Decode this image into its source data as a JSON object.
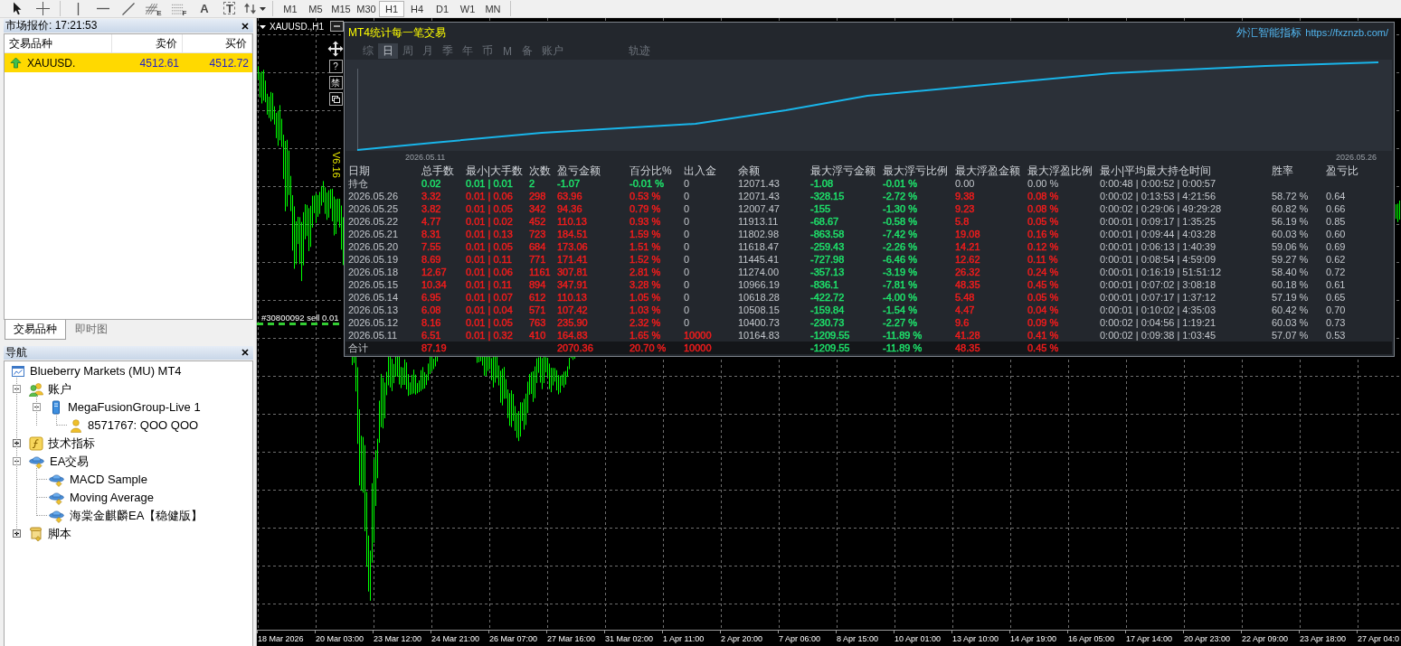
{
  "toolbar": {
    "tools": [
      {
        "kind": "cursor"
      },
      {
        "kind": "crosshair"
      },
      {
        "kind": "vertical-line"
      },
      {
        "kind": "horizontal-line"
      },
      {
        "kind": "trend-line"
      },
      {
        "kind": "fibonacci",
        "letter": "E"
      },
      {
        "kind": "fibonacci-levels",
        "letter": "F"
      },
      {
        "kind": "text",
        "label": "A"
      },
      {
        "kind": "text-label",
        "label": "T"
      },
      {
        "kind": "arrows"
      }
    ],
    "periods": [
      {
        "label": "M1",
        "selected": false
      },
      {
        "label": "M5",
        "selected": false
      },
      {
        "label": "M15",
        "selected": false
      },
      {
        "label": "M30",
        "selected": false
      },
      {
        "label": "H1",
        "selected": true
      },
      {
        "label": "H4",
        "selected": false
      },
      {
        "label": "D1",
        "selected": false
      },
      {
        "label": "W1",
        "selected": false
      },
      {
        "label": "MN",
        "selected": false
      }
    ]
  },
  "market_watch": {
    "title": "市场报价: 17:21:53",
    "columns": [
      "交易品种",
      "卖价",
      "买价"
    ],
    "rows": [
      {
        "symbol": "XAUUSD.",
        "bid": "4512.61",
        "ask": "4512.72",
        "rising": true,
        "selected": true
      }
    ],
    "tabs": [
      {
        "label": "交易品种",
        "selected": true
      },
      {
        "label": "即时图",
        "selected": false
      }
    ]
  },
  "navigator": {
    "title": "导航",
    "tree": [
      {
        "label": "Blueberry Markets (MU) MT4",
        "kind": "terminal",
        "children": [
          {
            "label": "账户",
            "kind": "accounts",
            "expanded": true,
            "children": [
              {
                "label": "MegaFusionGroup-Live 1",
                "kind": "server",
                "expanded": true,
                "children": [
                  {
                    "label": "8571767: QOO QOO",
                    "kind": "account"
                  }
                ]
              }
            ]
          },
          {
            "label": "技术指标",
            "kind": "indicators",
            "expanded": false
          },
          {
            "label": "EA交易",
            "kind": "experts",
            "expanded": true,
            "children": [
              {
                "label": "MACD Sample",
                "kind": "expert"
              },
              {
                "label": "Moving Average",
                "kind": "expert"
              },
              {
                "label": "海棠金麒麟EA【稳健版】",
                "kind": "expert"
              }
            ]
          },
          {
            "label": "脚本",
            "kind": "scripts",
            "expanded": false
          }
        ]
      }
    ]
  },
  "chart": {
    "title": "XAUUSD.,H1",
    "side_buttons": [
      {
        "kind": "move"
      },
      {
        "kind": "text",
        "label": "?"
      },
      {
        "kind": "text",
        "label": "禁"
      },
      {
        "kind": "window"
      }
    ],
    "version": "V6.16",
    "order_label": "#30800092 sell 0.01",
    "time_axis": [
      "18 Mar 2026",
      "20 Mar 03:00",
      "23 Mar 12:00",
      "24 Mar 21:00",
      "26 Mar 07:00",
      "27 Mar 16:00",
      "31 Mar 02:00",
      "1 Apr 11:00",
      "2 Apr 20:00",
      "7 Apr 06:00",
      "8 Apr 15:00",
      "10 Apr 01:00",
      "13 Apr 10:00",
      "14 Apr 19:00",
      "16 Apr 05:00",
      "17 Apr 14:00",
      "20 Apr 23:00",
      "22 Apr 09:00",
      "23 Apr 18:00",
      "27 Apr 04:0"
    ]
  },
  "stats_panel": {
    "title": "MT4统计每一笔交易",
    "brand": "外汇智能指标",
    "link": "https://fxznzb.com/",
    "tab_groups": [
      [
        {
          "label": "综",
          "selected": false
        },
        {
          "label": "日",
          "selected": true
        },
        {
          "label": "周",
          "selected": false
        },
        {
          "label": "月",
          "selected": false
        },
        {
          "label": "季",
          "selected": false
        },
        {
          "label": "年",
          "selected": false
        },
        {
          "label": "币",
          "selected": false
        },
        {
          "label": "M",
          "selected": false
        },
        {
          "label": "备",
          "selected": false
        },
        {
          "label": "账户",
          "selected": false
        }
      ],
      [
        {
          "label": "轨迹",
          "selected": false
        }
      ]
    ],
    "equity_dates": [
      "2026.05.11",
      "2026.05.26"
    ],
    "table": {
      "columns": [
        "日期",
        "总手数",
        "最小|大手数",
        "次数",
        "盈亏金额",
        "百分比%",
        "出入金",
        "余额",
        "最大浮亏金额",
        "最大浮亏比例",
        "最大浮盈金额",
        "最大浮盈比例",
        "最小|平均最大持仓时间",
        "胜率",
        "盈亏比"
      ],
      "rows": [
        {
          "kind": "data",
          "date": {
            "text": "持仓"
          },
          "lots": {
            "text": "0.02",
            "color": "#1ee36b"
          },
          "min_max_lots": {
            "text": "0.01 | 0.01",
            "color": "#1ee36b"
          },
          "trades": {
            "text": "2",
            "color": "#1ee36b"
          },
          "profit": {
            "text": "-1.07",
            "color": "#1ee36b"
          },
          "percent": {
            "text": "-0.01 %",
            "color": "#1ee36b"
          },
          "deposit": {
            "text": "0"
          },
          "balance": {
            "text": "12071.43"
          },
          "max_float_loss": {
            "text": "-1.08",
            "color": "#1ee36b"
          },
          "max_float_loss_pct": {
            "text": "-0.01 %",
            "color": "#1ee36b"
          },
          "max_float_profit": {
            "text": "0.00"
          },
          "max_float_profit_pct": {
            "text": "0.00 %"
          },
          "hold_time": {
            "text": "0:00:48 | 0:00:52 | 0:00:57"
          }
        },
        {
          "kind": "data",
          "date": {
            "text": "2026.05.26"
          },
          "lots": {
            "text": "3.32",
            "color": "#f21c1c"
          },
          "min_max_lots": {
            "text": "0.01 | 0.06",
            "color": "#f21c1c"
          },
          "trades": {
            "text": "298",
            "color": "#f21c1c"
          },
          "profit": {
            "text": "63.96",
            "color": "#f21c1c"
          },
          "percent": {
            "text": "0.53 %",
            "color": "#f21c1c"
          },
          "deposit": {
            "text": "0"
          },
          "balance": {
            "text": "12071.43"
          },
          "max_float_loss": {
            "text": "-328.15",
            "color": "#1ee36b"
          },
          "max_float_loss_pct": {
            "text": "-2.72 %",
            "color": "#1ee36b"
          },
          "max_float_profit": {
            "text": "9.38",
            "color": "#f21c1c"
          },
          "max_float_profit_pct": {
            "text": "0.08 %",
            "color": "#f21c1c"
          },
          "hold_time": {
            "text": "0:00:02 | 0:13:53 | 4:21:56"
          },
          "win_rate": {
            "text": "58.72 %"
          },
          "profit_ratio": {
            "text": "0.64"
          }
        },
        {
          "kind": "data",
          "date": {
            "text": "2026.05.25"
          },
          "lots": {
            "text": "3.82",
            "color": "#f21c1c"
          },
          "min_max_lots": {
            "text": "0.01 | 0.05",
            "color": "#f21c1c"
          },
          "trades": {
            "text": "342",
            "color": "#f21c1c"
          },
          "profit": {
            "text": "94.36",
            "color": "#f21c1c"
          },
          "percent": {
            "text": "0.79 %",
            "color": "#f21c1c"
          },
          "deposit": {
            "text": "0"
          },
          "balance": {
            "text": "12007.47"
          },
          "max_float_loss": {
            "text": "-155",
            "color": "#1ee36b"
          },
          "max_float_loss_pct": {
            "text": "-1.30 %",
            "color": "#1ee36b"
          },
          "max_float_profit": {
            "text": "9.23",
            "color": "#f21c1c"
          },
          "max_float_profit_pct": {
            "text": "0.08 %",
            "color": "#f21c1c"
          },
          "hold_time": {
            "text": "0:00:02 | 0:29:06 | 49:29:28"
          },
          "win_rate": {
            "text": "60.82 %"
          },
          "profit_ratio": {
            "text": "0.66"
          }
        },
        {
          "kind": "data",
          "date": {
            "text": "2026.05.22"
          },
          "lots": {
            "text": "4.77",
            "color": "#f21c1c"
          },
          "min_max_lots": {
            "text": "0.01 | 0.02",
            "color": "#f21c1c"
          },
          "trades": {
            "text": "452",
            "color": "#f21c1c"
          },
          "profit": {
            "text": "110.13",
            "color": "#f21c1c"
          },
          "percent": {
            "text": "0.93 %",
            "color": "#f21c1c"
          },
          "deposit": {
            "text": "0"
          },
          "balance": {
            "text": "11913.11"
          },
          "max_float_loss": {
            "text": "-68.67",
            "color": "#1ee36b"
          },
          "max_float_loss_pct": {
            "text": "-0.58 %",
            "color": "#1ee36b"
          },
          "max_float_profit": {
            "text": "5.8",
            "color": "#f21c1c"
          },
          "max_float_profit_pct": {
            "text": "0.05 %",
            "color": "#f21c1c"
          },
          "hold_time": {
            "text": "0:00:01 | 0:09:17 | 1:35:25"
          },
          "win_rate": {
            "text": "56.19 %"
          },
          "profit_ratio": {
            "text": "0.85"
          }
        },
        {
          "kind": "data",
          "date": {
            "text": "2026.05.21"
          },
          "lots": {
            "text": "8.31",
            "color": "#f21c1c"
          },
          "min_max_lots": {
            "text": "0.01 | 0.13",
            "color": "#f21c1c"
          },
          "trades": {
            "text": "723",
            "color": "#f21c1c"
          },
          "profit": {
            "text": "184.51",
            "color": "#f21c1c"
          },
          "percent": {
            "text": "1.59 %",
            "color": "#f21c1c"
          },
          "deposit": {
            "text": "0"
          },
          "balance": {
            "text": "11802.98"
          },
          "max_float_loss": {
            "text": "-863.58",
            "color": "#1ee36b"
          },
          "max_float_loss_pct": {
            "text": "-7.42 %",
            "color": "#1ee36b"
          },
          "max_float_profit": {
            "text": "19.08",
            "color": "#f21c1c"
          },
          "max_float_profit_pct": {
            "text": "0.16 %",
            "color": "#f21c1c"
          },
          "hold_time": {
            "text": "0:00:01 | 0:09:44 | 4:03:28"
          },
          "win_rate": {
            "text": "60.03 %"
          },
          "profit_ratio": {
            "text": "0.60"
          }
        },
        {
          "kind": "data",
          "date": {
            "text": "2026.05.20"
          },
          "lots": {
            "text": "7.55",
            "color": "#f21c1c"
          },
          "min_max_lots": {
            "text": "0.01 | 0.05",
            "color": "#f21c1c"
          },
          "trades": {
            "text": "684",
            "color": "#f21c1c"
          },
          "profit": {
            "text": "173.06",
            "color": "#f21c1c"
          },
          "percent": {
            "text": "1.51 %",
            "color": "#f21c1c"
          },
          "deposit": {
            "text": "0"
          },
          "balance": {
            "text": "11618.47"
          },
          "max_float_loss": {
            "text": "-259.43",
            "color": "#1ee36b"
          },
          "max_float_loss_pct": {
            "text": "-2.26 %",
            "color": "#1ee36b"
          },
          "max_float_profit": {
            "text": "14.21",
            "color": "#f21c1c"
          },
          "max_float_profit_pct": {
            "text": "0.12 %",
            "color": "#f21c1c"
          },
          "hold_time": {
            "text": "0:00:01 | 0:06:13 | 1:40:39"
          },
          "win_rate": {
            "text": "59.06 %"
          },
          "profit_ratio": {
            "text": "0.69"
          }
        },
        {
          "kind": "data",
          "date": {
            "text": "2026.05.19"
          },
          "lots": {
            "text": "8.69",
            "color": "#f21c1c"
          },
          "min_max_lots": {
            "text": "0.01 | 0.11",
            "color": "#f21c1c"
          },
          "trades": {
            "text": "771",
            "color": "#f21c1c"
          },
          "profit": {
            "text": "171.41",
            "color": "#f21c1c"
          },
          "percent": {
            "text": "1.52 %",
            "color": "#f21c1c"
          },
          "deposit": {
            "text": "0"
          },
          "balance": {
            "text": "11445.41"
          },
          "max_float_loss": {
            "text": "-727.98",
            "color": "#1ee36b"
          },
          "max_float_loss_pct": {
            "text": "-6.46 %",
            "color": "#1ee36b"
          },
          "max_float_profit": {
            "text": "12.62",
            "color": "#f21c1c"
          },
          "max_float_profit_pct": {
            "text": "0.11 %",
            "color": "#f21c1c"
          },
          "hold_time": {
            "text": "0:00:01 | 0:08:54 | 4:59:09"
          },
          "win_rate": {
            "text": "59.27 %"
          },
          "profit_ratio": {
            "text": "0.62"
          }
        },
        {
          "kind": "data",
          "date": {
            "text": "2026.05.18"
          },
          "lots": {
            "text": "12.67",
            "color": "#f21c1c"
          },
          "min_max_lots": {
            "text": "0.01 | 0.06",
            "color": "#f21c1c"
          },
          "trades": {
            "text": "1161",
            "color": "#f21c1c"
          },
          "profit": {
            "text": "307.81",
            "color": "#f21c1c"
          },
          "percent": {
            "text": "2.81 %",
            "color": "#f21c1c"
          },
          "deposit": {
            "text": "0"
          },
          "balance": {
            "text": "11274.00"
          },
          "max_float_loss": {
            "text": "-357.13",
            "color": "#1ee36b"
          },
          "max_float_loss_pct": {
            "text": "-3.19 %",
            "color": "#1ee36b"
          },
          "max_float_profit": {
            "text": "26.32",
            "color": "#f21c1c"
          },
          "max_float_profit_pct": {
            "text": "0.24 %",
            "color": "#f21c1c"
          },
          "hold_time": {
            "text": "0:00:01 | 0:16:19 | 51:51:12"
          },
          "win_rate": {
            "text": "58.40 %"
          },
          "profit_ratio": {
            "text": "0.72"
          }
        },
        {
          "kind": "data",
          "date": {
            "text": "2026.05.15"
          },
          "lots": {
            "text": "10.34",
            "color": "#f21c1c"
          },
          "min_max_lots": {
            "text": "0.01 | 0.11",
            "color": "#f21c1c"
          },
          "trades": {
            "text": "894",
            "color": "#f21c1c"
          },
          "profit": {
            "text": "347.91",
            "color": "#f21c1c"
          },
          "percent": {
            "text": "3.28 %",
            "color": "#f21c1c"
          },
          "deposit": {
            "text": "0"
          },
          "balance": {
            "text": "10966.19"
          },
          "max_float_loss": {
            "text": "-836.1",
            "color": "#1ee36b"
          },
          "max_float_loss_pct": {
            "text": "-7.81 %",
            "color": "#1ee36b"
          },
          "max_float_profit": {
            "text": "48.35",
            "color": "#f21c1c"
          },
          "max_float_profit_pct": {
            "text": "0.45 %",
            "color": "#f21c1c"
          },
          "hold_time": {
            "text": "0:00:01 | 0:07:02 | 3:08:18"
          },
          "win_rate": {
            "text": "60.18 %"
          },
          "profit_ratio": {
            "text": "0.61"
          }
        },
        {
          "kind": "data",
          "date": {
            "text": "2026.05.14"
          },
          "lots": {
            "text": "6.95",
            "color": "#f21c1c"
          },
          "min_max_lots": {
            "text": "0.01 | 0.07",
            "color": "#f21c1c"
          },
          "trades": {
            "text": "612",
            "color": "#f21c1c"
          },
          "profit": {
            "text": "110.13",
            "color": "#f21c1c"
          },
          "percent": {
            "text": "1.05 %",
            "color": "#f21c1c"
          },
          "deposit": {
            "text": "0"
          },
          "balance": {
            "text": "10618.28"
          },
          "max_float_loss": {
            "text": "-422.72",
            "color": "#1ee36b"
          },
          "max_float_loss_pct": {
            "text": "-4.00 %",
            "color": "#1ee36b"
          },
          "max_float_profit": {
            "text": "5.48",
            "color": "#f21c1c"
          },
          "max_float_profit_pct": {
            "text": "0.05 %",
            "color": "#f21c1c"
          },
          "hold_time": {
            "text": "0:00:01 | 0:07:17 | 1:37:12"
          },
          "win_rate": {
            "text": "57.19 %"
          },
          "profit_ratio": {
            "text": "0.65"
          }
        },
        {
          "kind": "data",
          "date": {
            "text": "2026.05.13"
          },
          "lots": {
            "text": "6.08",
            "color": "#f21c1c"
          },
          "min_max_lots": {
            "text": "0.01 | 0.04",
            "color": "#f21c1c"
          },
          "trades": {
            "text": "571",
            "color": "#f21c1c"
          },
          "profit": {
            "text": "107.42",
            "color": "#f21c1c"
          },
          "percent": {
            "text": "1.03 %",
            "color": "#f21c1c"
          },
          "deposit": {
            "text": "0"
          },
          "balance": {
            "text": "10508.15"
          },
          "max_float_loss": {
            "text": "-159.84",
            "color": "#1ee36b"
          },
          "max_float_loss_pct": {
            "text": "-1.54 %",
            "color": "#1ee36b"
          },
          "max_float_profit": {
            "text": "4.47",
            "color": "#f21c1c"
          },
          "max_float_profit_pct": {
            "text": "0.04 %",
            "color": "#f21c1c"
          },
          "hold_time": {
            "text": "0:00:01 | 0:10:02 | 4:35:03"
          },
          "win_rate": {
            "text": "60.42 %"
          },
          "profit_ratio": {
            "text": "0.70"
          }
        },
        {
          "kind": "data",
          "date": {
            "text": "2026.05.12"
          },
          "lots": {
            "text": "8.16",
            "color": "#f21c1c"
          },
          "min_max_lots": {
            "text": "0.01 | 0.05",
            "color": "#f21c1c"
          },
          "trades": {
            "text": "763",
            "color": "#f21c1c"
          },
          "profit": {
            "text": "235.90",
            "color": "#f21c1c"
          },
          "percent": {
            "text": "2.32 %",
            "color": "#f21c1c"
          },
          "deposit": {
            "text": "0"
          },
          "balance": {
            "text": "10400.73"
          },
          "max_float_loss": {
            "text": "-230.73",
            "color": "#1ee36b"
          },
          "max_float_loss_pct": {
            "text": "-2.27 %",
            "color": "#1ee36b"
          },
          "max_float_profit": {
            "text": "9.6",
            "color": "#f21c1c"
          },
          "max_float_profit_pct": {
            "text": "0.09 %",
            "color": "#f21c1c"
          },
          "hold_time": {
            "text": "0:00:02 | 0:04:56 | 1:19:21"
          },
          "win_rate": {
            "text": "60.03 %"
          },
          "profit_ratio": {
            "text": "0.73"
          }
        },
        {
          "kind": "data",
          "date": {
            "text": "2026.05.11"
          },
          "lots": {
            "text": "6.51",
            "color": "#f21c1c"
          },
          "min_max_lots": {
            "text": "0.01 | 0.32",
            "color": "#f21c1c"
          },
          "trades": {
            "text": "410",
            "color": "#f21c1c"
          },
          "profit": {
            "text": "164.83",
            "color": "#f21c1c"
          },
          "percent": {
            "text": "1.65 %",
            "color": "#f21c1c"
          },
          "deposit": {
            "text": "10000",
            "color": "#f21c1c"
          },
          "balance": {
            "text": "10164.83"
          },
          "max_float_loss": {
            "text": "-1209.55",
            "color": "#1ee36b"
          },
          "max_float_loss_pct": {
            "text": "-11.89 %",
            "color": "#1ee36b"
          },
          "max_float_profit": {
            "text": "41.28",
            "color": "#f21c1c"
          },
          "max_float_profit_pct": {
            "text": "0.41 %",
            "color": "#f21c1c"
          },
          "hold_time": {
            "text": "0:00:02 | 0:09:38 | 1:03:45"
          },
          "win_rate": {
            "text": "57.07 %"
          },
          "profit_ratio": {
            "text": "0.53"
          }
        },
        {
          "kind": "total",
          "date": {
            "text": "合计"
          },
          "lots": {
            "text": "87.19",
            "color": "#f21c1c"
          },
          "profit": {
            "text": "2070.36",
            "color": "#f21c1c"
          },
          "percent": {
            "text": "20.70 %",
            "color": "#f21c1c"
          },
          "deposit": {
            "text": "10000",
            "color": "#f21c1c"
          },
          "max_float_loss": {
            "text": "-1209.55",
            "color": "#1ee36b"
          },
          "max_float_loss_pct": {
            "text": "-11.89 %",
            "color": "#1ee36b"
          },
          "max_float_profit": {
            "text": "48.35",
            "color": "#f21c1c"
          },
          "max_float_profit_pct": {
            "text": "0.45 %",
            "color": "#f21c1c"
          }
        }
      ]
    }
  }
}
